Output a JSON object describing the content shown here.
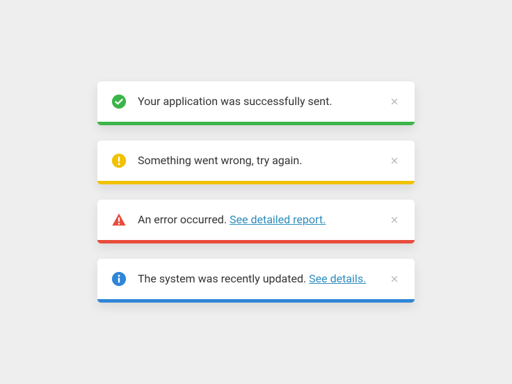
{
  "toasts": [
    {
      "type": "success",
      "icon": "check-circle-icon",
      "color": "#3bb54a",
      "message": "Your application was successfully sent.",
      "link_text": null
    },
    {
      "type": "warning",
      "icon": "exclamation-circle-icon",
      "color": "#f2c100",
      "message": "Something went wrong, try again.",
      "link_text": null
    },
    {
      "type": "error",
      "icon": "exclamation-triangle-icon",
      "color": "#e84c3d",
      "message": "An error occurred. ",
      "link_text": "See detailed report."
    },
    {
      "type": "info",
      "icon": "info-circle-icon",
      "color": "#2f86d6",
      "message": "The system was recently updated. ",
      "link_text": "See details."
    }
  ]
}
